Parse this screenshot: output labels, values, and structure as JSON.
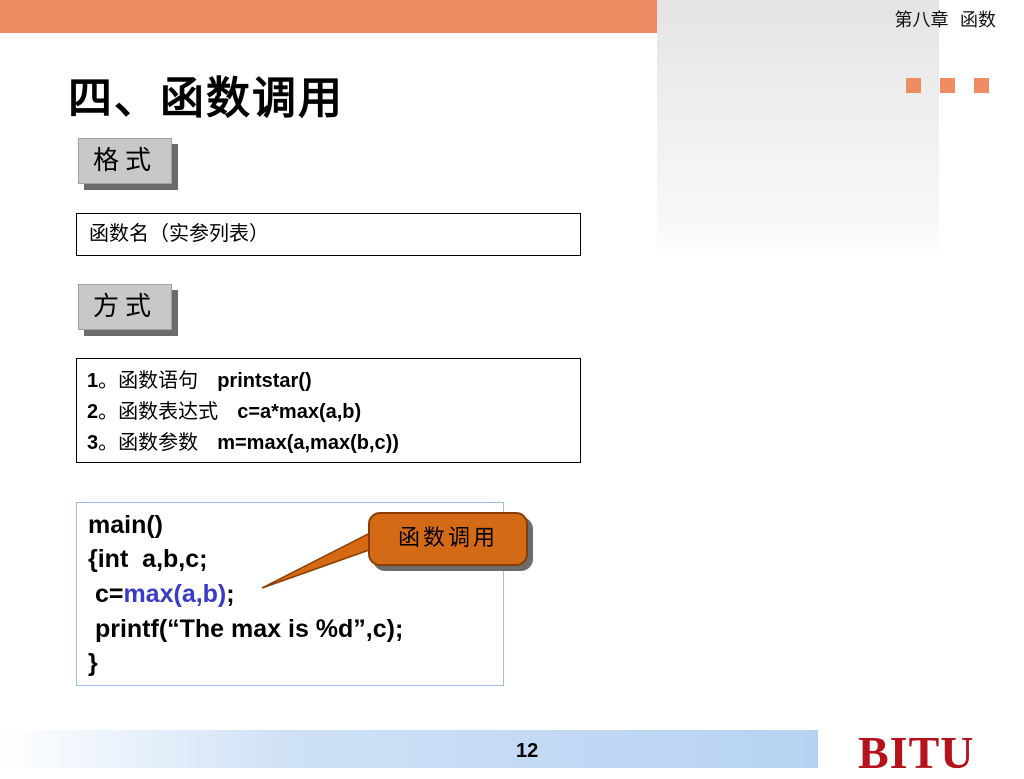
{
  "header": {
    "chapter_title": "第八章  函数",
    "accent_color": "#f08c64"
  },
  "slide": {
    "title": "四、函数调用"
  },
  "format_section": {
    "label": "格式",
    "content": "函数名（实参列表）"
  },
  "method_section": {
    "label": "方式",
    "items": [
      {
        "num": "1",
        "sep": "。",
        "desc": "函数语句",
        "code": "printstar()"
      },
      {
        "num": "2",
        "sep": "。",
        "desc": "函数表达式",
        "code": "c=a*max(a,b)"
      },
      {
        "num": "3",
        "sep": "。",
        "desc": "函数参数",
        "code": "m=max(a,max(b,c))"
      }
    ]
  },
  "code_example": {
    "line1": "main()",
    "line2": "{int  a,b,c;",
    "line3_pre": " c=",
    "line3_call": "max(a,b)",
    "line3_post": ";",
    "line4": " printf(“The max is %d”,c);",
    "line5": "}",
    "highlight_color": "#3a3ac8"
  },
  "callout": {
    "label": "函数调用",
    "color": "#d46a16"
  },
  "footer": {
    "page_number": "12",
    "logo": "BITU",
    "logo_color": "#b5121b"
  }
}
